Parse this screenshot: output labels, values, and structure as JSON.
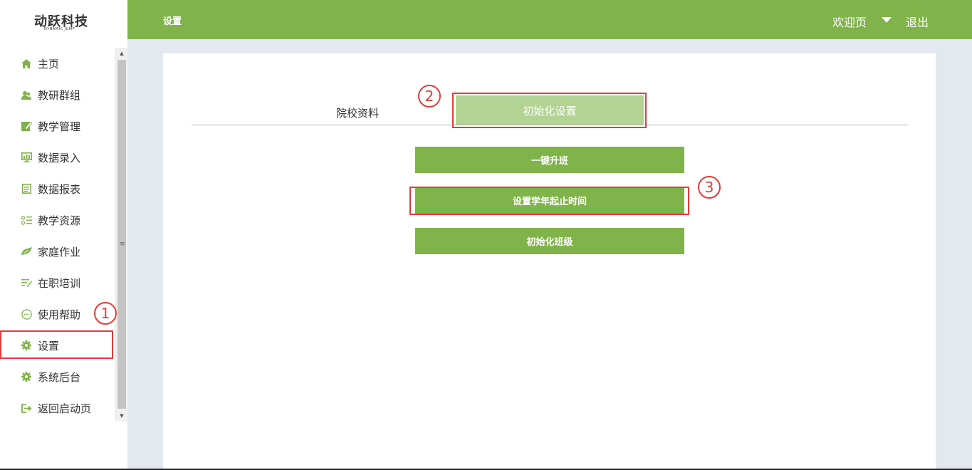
{
  "logo": {
    "main": "动跃科技",
    "sub": "DYNAMIC JUMP"
  },
  "header": {
    "title": "设置",
    "welcome": "欢迎页",
    "logout": "退出"
  },
  "sidebar": {
    "items": [
      {
        "label": "主页",
        "icon": "home-icon"
      },
      {
        "label": "教研群组",
        "icon": "users-icon"
      },
      {
        "label": "教学管理",
        "icon": "edit-icon"
      },
      {
        "label": "数据录入",
        "icon": "monitor-icon"
      },
      {
        "label": "数据报表",
        "icon": "report-icon"
      },
      {
        "label": "教学资源",
        "icon": "list-icon"
      },
      {
        "label": "家庭作业",
        "icon": "homework-icon"
      },
      {
        "label": "在职培训",
        "icon": "training-icon"
      },
      {
        "label": "使用帮助",
        "icon": "help-icon"
      },
      {
        "label": "设置",
        "icon": "gear-icon"
      },
      {
        "label": "系统后台",
        "icon": "gear-icon"
      },
      {
        "label": "返回启动页",
        "icon": "exit-icon"
      }
    ]
  },
  "tabs": {
    "school_info": "院校资料",
    "init_settings": "初始化设置"
  },
  "actions": {
    "upgrade": "一键升班",
    "school_year": "设置学年起止时间",
    "init_class": "初始化班级"
  },
  "annotations": {
    "step1": "1",
    "step2": "2",
    "step3": "3"
  },
  "colors": {
    "accent": "#80b34a",
    "tab_active": "#b3d395",
    "highlight": "#e63a3a",
    "background": "#e4e9f0"
  }
}
